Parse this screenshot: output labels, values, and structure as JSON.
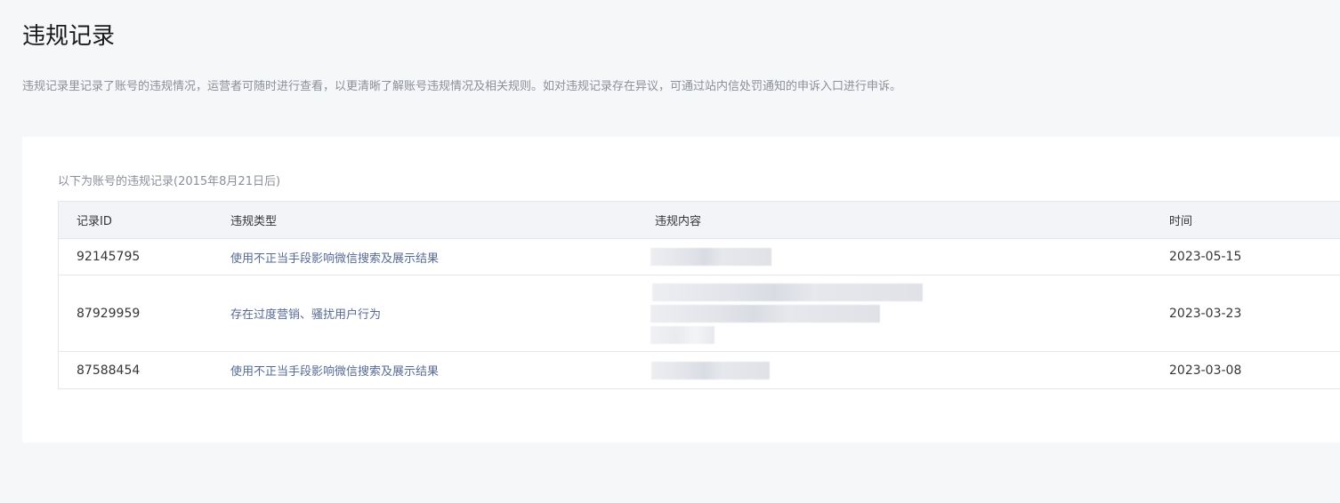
{
  "page": {
    "title": "违规记录",
    "description": "违规记录里记录了账号的违规情况，运营者可随时进行查看，以更清晰了解账号违规情况及相关规则。如对违规记录存在异议，可通过站内信处罚通知的申诉入口进行申诉。"
  },
  "records": {
    "caption": "以下为账号的违规记录(2015年8月21日后)",
    "columns": {
      "id": "记录ID",
      "type": "违规类型",
      "content": "违规内容",
      "time": "时间"
    },
    "rows": [
      {
        "id": "92145795",
        "type": "使用不正当手段影响微信搜索及展示结果",
        "content_redacted": true,
        "time": "2023-05-15"
      },
      {
        "id": "87929959",
        "type": "存在过度营销、骚扰用户行为",
        "content_redacted": true,
        "time": "2023-03-23"
      },
      {
        "id": "87588454",
        "type": "使用不正当手段影响微信搜索及展示结果",
        "content_redacted": true,
        "time": "2023-03-08"
      }
    ]
  },
  "colors": {
    "background": "#f6f7f9",
    "card": "#ffffff",
    "table_header": "#f3f4f7",
    "link_text": "#576b95",
    "muted_text": "#8a8f99"
  }
}
